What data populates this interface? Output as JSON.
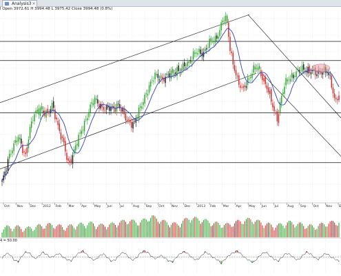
{
  "window": {
    "tab_title": "Analysis3"
  },
  "header": {
    "ohlc_text": "l Open 3972.61 H 3994.48 L 3975.42 Close 3994.48 (0.8%)"
  },
  "rsi": {
    "label": "4 = 50.00",
    "level": 50
  },
  "colors": {
    "up": "#22a322",
    "down": "#d42020",
    "neutral": "#111111",
    "ma": "#2c3ec8",
    "line": "#111111",
    "circle": "#f2a0a8"
  },
  "chart_data": {
    "type": "candlestick",
    "x_ticks": [
      "Oct",
      "Nov",
      "Dec",
      "2012",
      "Feb",
      "Mar",
      "Apr",
      "May",
      "Jun",
      "Jul",
      "Aug",
      "Sep",
      "Oct",
      "Nov",
      "Dec",
      "2013",
      "Feb",
      "Mar",
      "Apr",
      "May",
      "Jun",
      "Jul",
      "Aug",
      "Sep",
      "Oct",
      "Nov",
      "Dec"
    ],
    "ylim": [
      0,
      100
    ],
    "price_path": [
      [
        0,
        10
      ],
      [
        1,
        18
      ],
      [
        2,
        32
      ],
      [
        3,
        40
      ],
      [
        4,
        45
      ],
      [
        5,
        37
      ],
      [
        6,
        30
      ],
      [
        7,
        50
      ],
      [
        8,
        60
      ],
      [
        9,
        64
      ],
      [
        10,
        68
      ],
      [
        11,
        65
      ],
      [
        12,
        62
      ],
      [
        13,
        70
      ],
      [
        14,
        60
      ],
      [
        15,
        48
      ],
      [
        16,
        38
      ],
      [
        17,
        24
      ],
      [
        18,
        30
      ],
      [
        19,
        38
      ],
      [
        20,
        45
      ],
      [
        21,
        54
      ],
      [
        22,
        63
      ],
      [
        23,
        70
      ],
      [
        24,
        73
      ],
      [
        25,
        71
      ],
      [
        26,
        69
      ],
      [
        27,
        66
      ],
      [
        28,
        67
      ],
      [
        29,
        69
      ],
      [
        30,
        71
      ],
      [
        31,
        64
      ],
      [
        32,
        59
      ],
      [
        33,
        58
      ],
      [
        34,
        55
      ],
      [
        35,
        61
      ],
      [
        36,
        70
      ],
      [
        37,
        79
      ],
      [
        38,
        84
      ],
      [
        39,
        90
      ],
      [
        40,
        94
      ],
      [
        41,
        92
      ],
      [
        42,
        90
      ],
      [
        43,
        93
      ],
      [
        44,
        96
      ],
      [
        45,
        98
      ],
      [
        46,
        96
      ],
      [
        47,
        100
      ],
      [
        48,
        104
      ],
      [
        49,
        108
      ],
      [
        50,
        110
      ],
      [
        51,
        111
      ],
      [
        52,
        112
      ],
      [
        53,
        117
      ],
      [
        54,
        119
      ],
      [
        55,
        121
      ],
      [
        56,
        128
      ],
      [
        57,
        137
      ],
      [
        58,
        136
      ],
      [
        59,
        112
      ],
      [
        60,
        100
      ],
      [
        61,
        87
      ],
      [
        62,
        81
      ],
      [
        63,
        88
      ],
      [
        64,
        93
      ],
      [
        65,
        97
      ],
      [
        66,
        99
      ],
      [
        67,
        95
      ],
      [
        68,
        87
      ],
      [
        69,
        78
      ],
      [
        70,
        68
      ],
      [
        71,
        60
      ],
      [
        72,
        74
      ],
      [
        73,
        85
      ],
      [
        74,
        91
      ],
      [
        75,
        94
      ],
      [
        76,
        95
      ],
      [
        77,
        97
      ],
      [
        78,
        99
      ],
      [
        79,
        98
      ],
      [
        80,
        96
      ],
      [
        81,
        94
      ],
      [
        82,
        97
      ],
      [
        83,
        98
      ],
      [
        84,
        95
      ],
      [
        85,
        87
      ],
      [
        86,
        74
      ],
      [
        87,
        79
      ]
    ],
    "horizontal_levels": [
      120,
      105,
      64,
      25
    ],
    "volume_pattern": [
      0.18,
      0.22,
      0.15,
      0.25,
      0.3,
      0.2,
      0.28,
      0.35,
      0.26,
      0.32,
      0.45,
      0.38,
      0.6,
      0.4,
      0.3,
      0.55,
      0.48,
      0.35,
      0.28,
      0.42,
      0.5,
      0.33,
      0.25,
      0.38,
      0.3,
      0.22,
      0.35,
      0.4
    ],
    "rsi_pattern": [
      45,
      62,
      58,
      40,
      35,
      55,
      68,
      60,
      44,
      52,
      66,
      58,
      48,
      55,
      62,
      50,
      42,
      38,
      52,
      64,
      70,
      56,
      44,
      40,
      54,
      60,
      48,
      36,
      42,
      58,
      66,
      52,
      40,
      46,
      62,
      70,
      64,
      50,
      44,
      56,
      48,
      38,
      34,
      50,
      62,
      68,
      58,
      46,
      40,
      52,
      66,
      60,
      48,
      42,
      30,
      44,
      56,
      64,
      70,
      58,
      46,
      38,
      32,
      48,
      60,
      66,
      54,
      44,
      36,
      50,
      62,
      58,
      46,
      40,
      54,
      66,
      60,
      48,
      42,
      56,
      62,
      50,
      44,
      36
    ]
  }
}
